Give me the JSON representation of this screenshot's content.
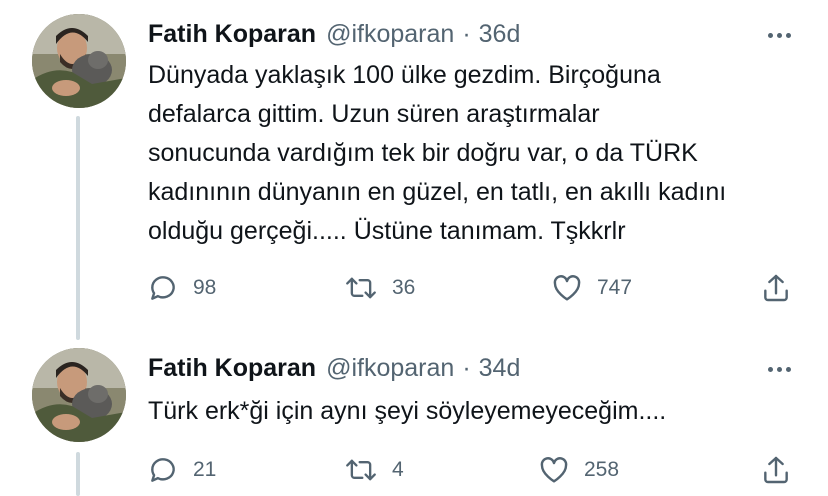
{
  "tweets": [
    {
      "author": {
        "name": "Fatih Koparan",
        "handle": "@ifkoparan"
      },
      "separator": "·",
      "time": "36d",
      "text_lines": [
        "Dünyada yaklaşık 100 ülke gezdim. Birçoğuna",
        "defalarca gittim. Uzun süren araştırmalar",
        "sonucunda vardığım tek bir doğru var, o da TÜRK",
        "kadınının dünyanın en güzel, en tatlı, en akıllı kadını",
        "olduğu gerçeği..... Üstüne tanımam. Tşkkrlr"
      ],
      "stats": {
        "replies": "98",
        "retweets": "36",
        "likes": "747"
      }
    },
    {
      "author": {
        "name": "Fatih Koparan",
        "handle": "@ifkoparan"
      },
      "separator": "·",
      "time": "34d",
      "text_lines": [
        "Türk erk*ği için aynı şeyi söyleyemeyeceğim...."
      ],
      "stats": {
        "replies": "21",
        "retweets": "4",
        "likes": "258"
      }
    }
  ],
  "icons": {
    "reply": "reply-icon",
    "retweet": "retweet-icon",
    "like": "heart-icon",
    "share": "share-icon",
    "more": "more-icon"
  },
  "colors": {
    "text": "#0f1419",
    "secondary": "#536471",
    "thread_line": "#cfd9de",
    "background": "#ffffff"
  }
}
